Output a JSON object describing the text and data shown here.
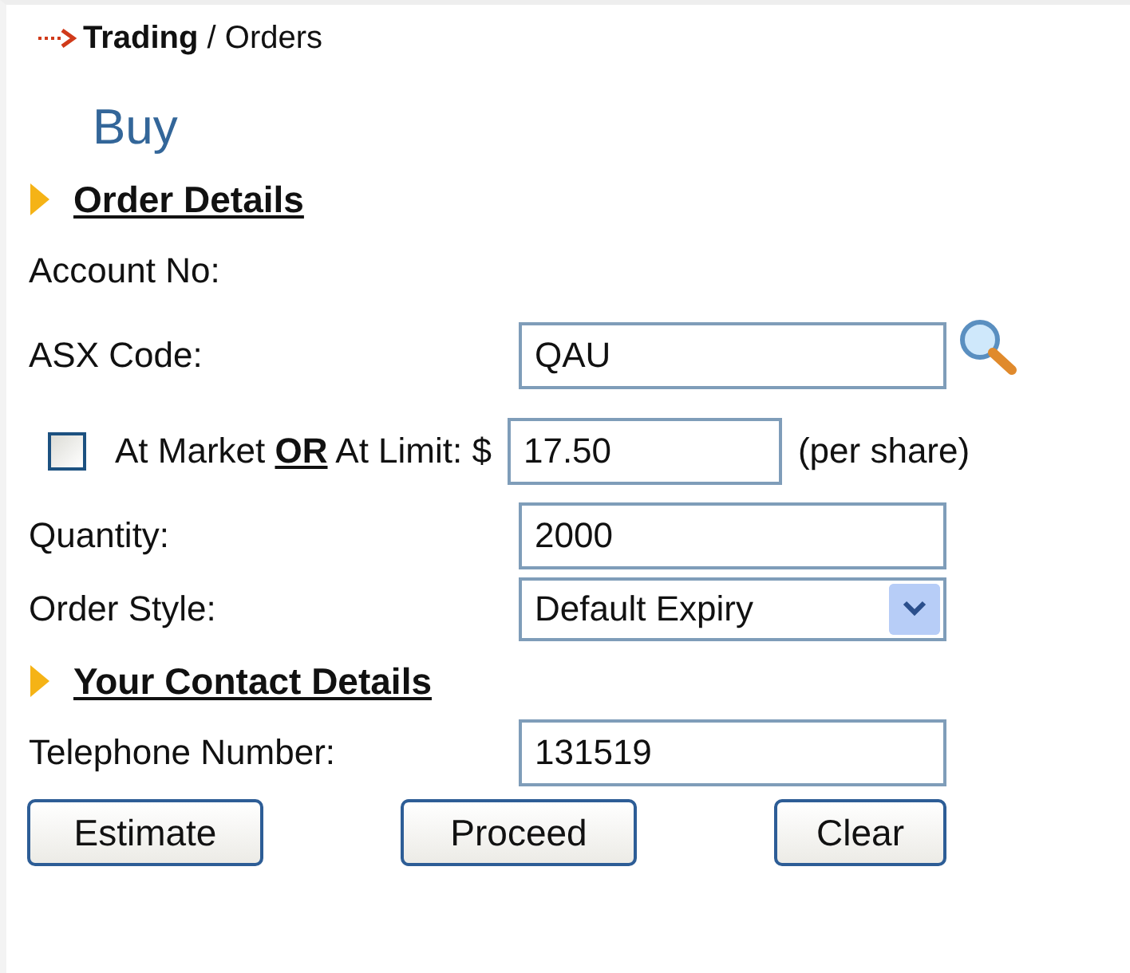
{
  "breadcrumb": "**Trading** / Orders",
  "title": "Buy",
  "sections": [
    {
      "heading": "Order Details",
      "rows": [
        {
          "kind": "text",
          "label": "Account No:"
        },
        {
          "kind": "input",
          "label": "ASX Code:",
          "value": "QAU",
          "lookup": true
        },
        {
          "kind": "limit",
          "checked": false,
          "label": "At Market **OR** At Limit: $",
          "value": "17.50",
          "suffix": "(per share)"
        },
        {
          "kind": "input",
          "label": "Quantity:",
          "value": "2000"
        },
        {
          "kind": "select",
          "label": "Order Style:",
          "value": "Default Expiry"
        }
      ]
    },
    {
      "heading": "Your Contact Details",
      "rows": [
        {
          "kind": "input",
          "label": "Telephone Number:",
          "value": "131519"
        }
      ]
    }
  ],
  "buttons": [
    "Estimate",
    "Proceed",
    "Clear"
  ]
}
